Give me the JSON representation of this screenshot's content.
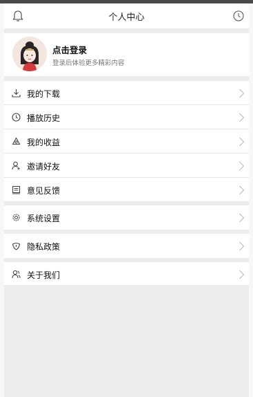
{
  "header": {
    "title": "个人中心",
    "left_icon": "bell-icon",
    "right_icon": "clock-icon"
  },
  "profile": {
    "login_label": "点击登录",
    "login_subtitle": "登录后体验更多精彩内容",
    "avatar_icon": "avatar-girl-icon"
  },
  "menu_groups": [
    {
      "items": [
        {
          "label": "我的下载",
          "icon": "download-icon"
        },
        {
          "label": "播放历史",
          "icon": "history-clock-icon"
        },
        {
          "label": "我的收益",
          "icon": "coin-icon"
        },
        {
          "label": "邀请好友",
          "icon": "add-user-icon"
        },
        {
          "label": "意见反馈",
          "icon": "feedback-icon"
        }
      ]
    },
    {
      "items": [
        {
          "label": "系统设置",
          "icon": "gear-icon"
        }
      ]
    },
    {
      "items": [
        {
          "label": "隐私政策",
          "icon": "shield-icon"
        }
      ]
    },
    {
      "items": [
        {
          "label": "关于我们",
          "icon": "users-icon"
        }
      ]
    }
  ],
  "colors": {
    "background": "#ececec",
    "text": "#111111",
    "subtext": "#777777",
    "divider": "#e4e4e4"
  }
}
